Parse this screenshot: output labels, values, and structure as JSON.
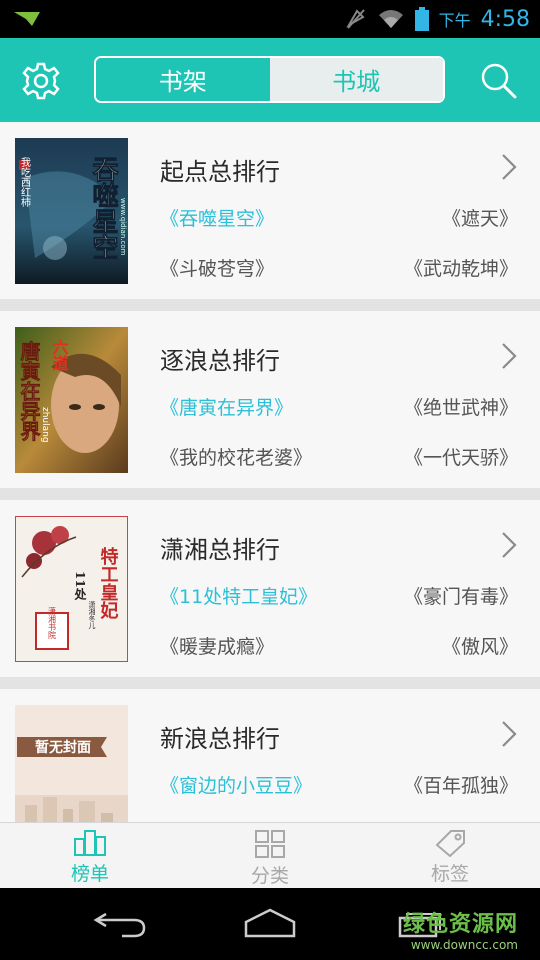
{
  "status_bar": {
    "ampm": "下午",
    "time": "4:58"
  },
  "header": {
    "tabs": [
      {
        "label": "书架",
        "active": true
      },
      {
        "label": "书城",
        "active": false
      }
    ]
  },
  "rankings": [
    {
      "title": "起点总排行",
      "books": [
        "《吞噬星空》",
        "《遮天》",
        "《斗破苍穹》",
        "《武动乾坤》"
      ],
      "cover_text": {
        "main": "吞噬星空",
        "side": "我吃西红柿",
        "url": "www.qidian.com"
      }
    },
    {
      "title": "逐浪总排行",
      "books": [
        "《唐寅在异界》",
        "《绝世武神》",
        "《我的校花老婆》",
        "《一代天骄》"
      ],
      "cover_text": {
        "main": "唐寅在异界",
        "side": "六道",
        "url": "zhulang"
      }
    },
    {
      "title": "潇湘总排行",
      "books": [
        "《11处特工皇妃》",
        "《豪门有毒》",
        "《暖妻成瘾》",
        "《傲风》"
      ],
      "cover_text": {
        "main": "特工皇妃",
        "side": "11处",
        "badge": "潇湘书院",
        "author": "潇湘冬儿"
      }
    },
    {
      "title": "新浪总排行",
      "books": [
        "《窗边的小豆豆》",
        "《百年孤独》"
      ],
      "cover_text": {
        "main": "暂无封面"
      }
    }
  ],
  "bottom_tabs": [
    {
      "label": "榜单",
      "icon": "building-icon",
      "active": true
    },
    {
      "label": "分类",
      "icon": "grid-icon",
      "active": false
    },
    {
      "label": "标签",
      "icon": "tag-icon",
      "active": false
    }
  ],
  "watermark": {
    "text": "绿色资源网",
    "url": "www.downcc.com"
  },
  "colors": {
    "accent": "#1ec4b4",
    "highlight_book": "#2cc0d8",
    "status_text": "#33b5e5"
  }
}
